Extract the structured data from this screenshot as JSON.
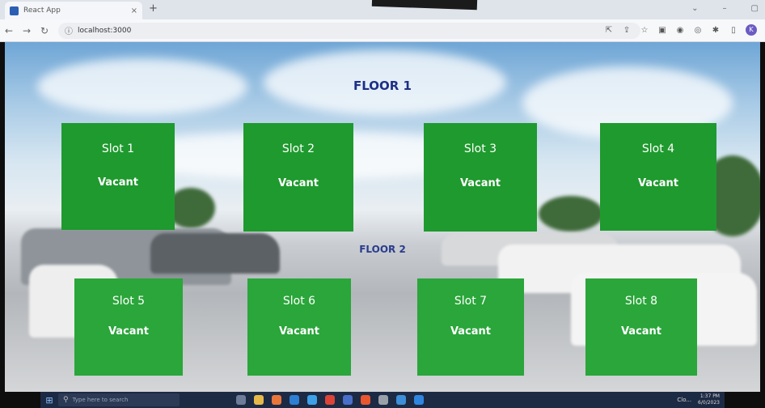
{
  "browser": {
    "tab_title": "React App",
    "tab_close": "×",
    "new_tab": "+",
    "url": "localhost:3000",
    "window_controls": [
      "⌄",
      "–",
      "▢"
    ],
    "profile_initial": "K"
  },
  "floors": [
    {
      "title": "FLOOR 1",
      "slots": [
        {
          "name": "Slot 1",
          "status": "Vacant"
        },
        {
          "name": "Slot 2",
          "status": "Vacant"
        },
        {
          "name": "Slot 3",
          "status": "Vacant"
        },
        {
          "name": "Slot 4",
          "status": "Vacant"
        }
      ]
    },
    {
      "title": "FLOOR 2",
      "slots": [
        {
          "name": "Slot 5",
          "status": "Vacant"
        },
        {
          "name": "Slot 6",
          "status": "Vacant"
        },
        {
          "name": "Slot 7",
          "status": "Vacant"
        },
        {
          "name": "Slot 8",
          "status": "Vacant"
        }
      ]
    }
  ],
  "taskbar": {
    "search_placeholder": "Type here to search",
    "weather_text": "Clo...",
    "time": "1:37 PM",
    "date": "6/0/2023"
  },
  "colors": {
    "slot_vacant": "#1f9a2e",
    "floor_title": "#1d2f86"
  }
}
